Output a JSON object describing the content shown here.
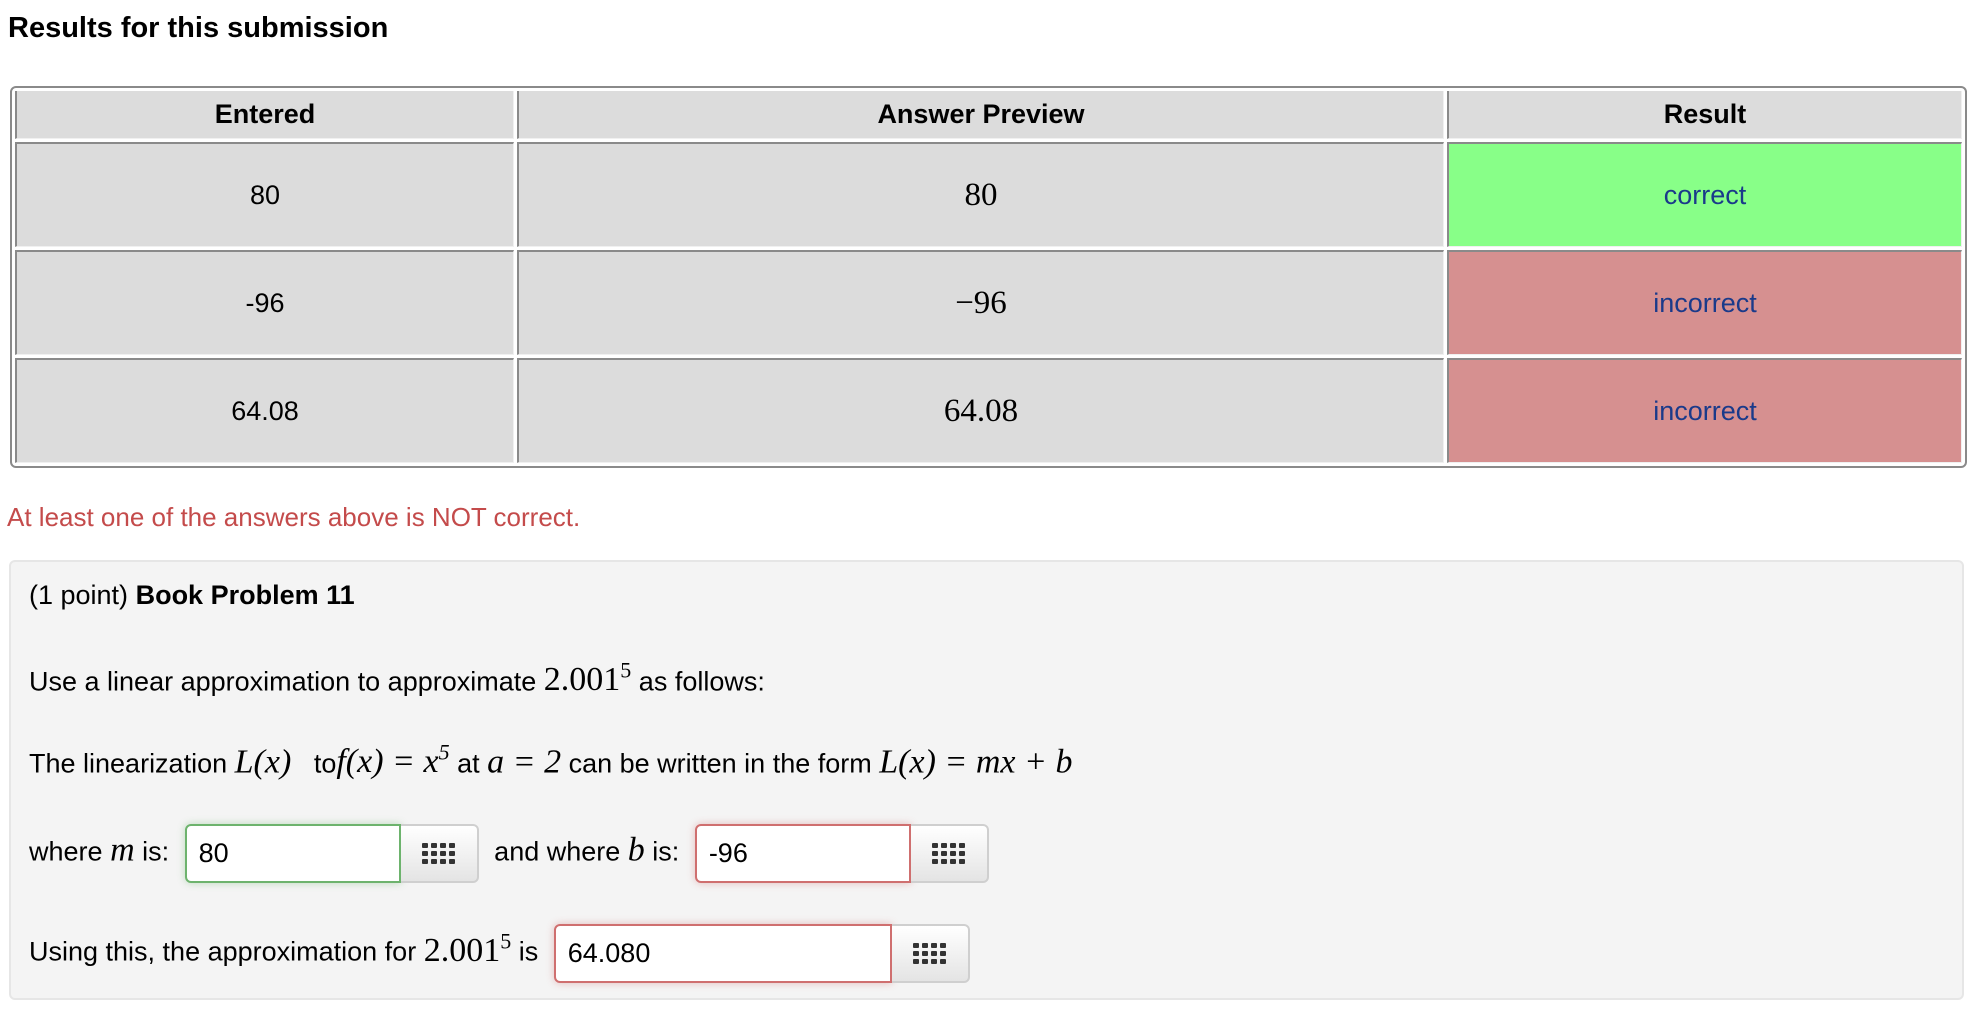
{
  "page": {
    "title": "Results for this submission"
  },
  "results_table": {
    "headers": [
      "Entered",
      "Answer Preview",
      "Result"
    ],
    "rows": [
      {
        "entered": "80",
        "preview": "80",
        "result": "correct",
        "status_color": "#88ff88"
      },
      {
        "entered": "-96",
        "preview": "−96",
        "result": "incorrect",
        "status_color": "#d69090"
      },
      {
        "entered": "64.08",
        "preview": "64.08",
        "result": "incorrect",
        "status_color": "#d69090"
      }
    ]
  },
  "feedback": {
    "message": "At least one of the answers above is NOT correct.",
    "color": "#c44b4b"
  },
  "problem": {
    "points": "(1 point)",
    "name": "Book Problem 11",
    "intro_prefix": "Use a linear approximation to approximate",
    "intro_base": "2.001",
    "intro_exp": "5",
    "intro_suffix": "as follows:",
    "lin_prefix": "The linearization",
    "lin_Lx": "L(x)",
    "lin_to": "to",
    "lin_f": "f(x) = x",
    "lin_f_exp": "5",
    "lin_at": "at",
    "lin_a": "a = 2",
    "lin_form": "can be written in the form",
    "lin_eq": "L(x) = mx + b",
    "m_label_prefix": "where",
    "m_var": "m",
    "m_label_suffix": "is:",
    "m_value": "80",
    "b_label_prefix": "and where",
    "b_var": "b",
    "b_label_suffix": "is:",
    "b_value": "-96",
    "approx_prefix": "Using this, the approximation for",
    "approx_base": "2.001",
    "approx_exp": "5",
    "approx_suffix": "is",
    "approx_value": "64.080",
    "keyboard_icon": "keypad-grid-icon"
  }
}
